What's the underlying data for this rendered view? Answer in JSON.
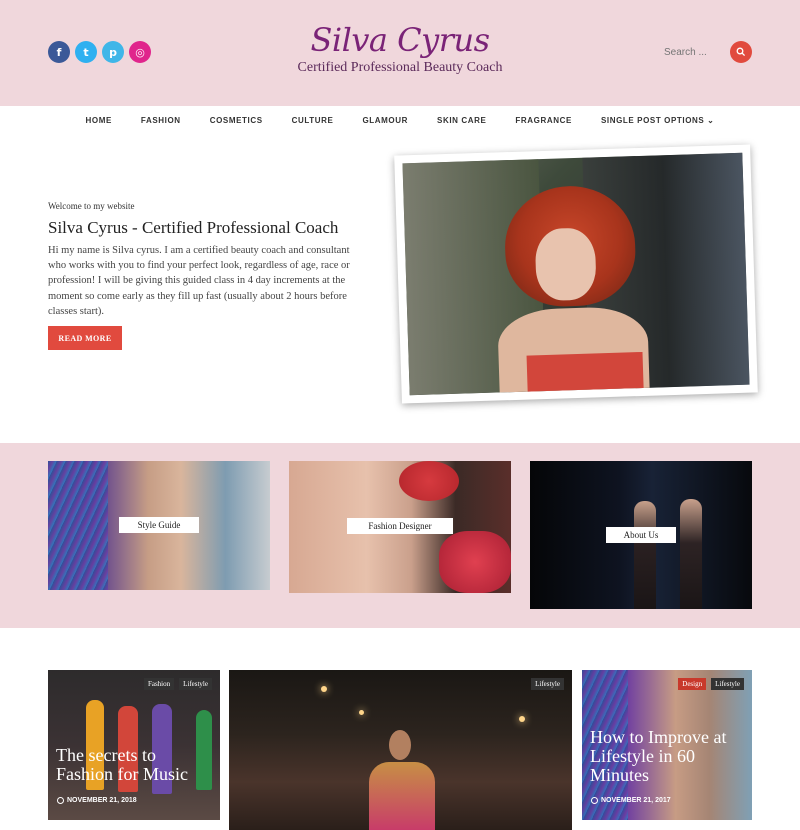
{
  "header": {
    "site_title": "Silva Cyrus",
    "tagline": "Certified Professional Beauty Coach",
    "search_placeholder": "Search ...",
    "social": [
      {
        "icon": "facebook-icon",
        "glyph": "f",
        "color": "#3b5998"
      },
      {
        "icon": "twitter-icon",
        "glyph": "t",
        "color": "#2fb0f0"
      },
      {
        "icon": "pinterest-icon",
        "glyph": "p",
        "color": "#3fb6e8"
      },
      {
        "icon": "instagram-icon",
        "glyph": "◎",
        "color": "#e0258c"
      }
    ]
  },
  "nav": {
    "items": [
      "HOME",
      "FASHION",
      "COSMETICS",
      "CULTURE",
      "GLAMOUR",
      "SKIN CARE",
      "FRAGRANCE",
      "SINGLE POST OPTIONS ⌄"
    ]
  },
  "intro": {
    "welcome": "Welcome to my website",
    "title": "Silva Cyrus - Certified Professional Coach",
    "text": "Hi my name is Silva cyrus. I am a certified beauty coach and consultant who works with you to find your perfect look, regardless of age, race or profession! I will be giving this guided class in 4 day increments at the moment so come early as they fill up fast (usually about 2 hours before classes start).",
    "button": "READ MORE"
  },
  "categories": [
    "Style Guide",
    "Fashion Designer",
    "About Us"
  ],
  "posts": [
    {
      "title": "The secrets to Fashion for Music",
      "date": "NOVEMBER 21, 2018",
      "tags": [
        "Fashion",
        "Lifestyle"
      ]
    },
    {
      "title": "",
      "date": "",
      "tags": [
        "Lifestyle"
      ]
    },
    {
      "title": "How to Improve at Lifestyle in 60 Minutes",
      "date": "NOVEMBER 21, 2017",
      "tags": [
        "Design",
        "Lifestyle"
      ]
    }
  ],
  "colors": {
    "accent": "#e14a3e",
    "header_bg": "#f0d7dc",
    "brand": "#7a2377"
  }
}
